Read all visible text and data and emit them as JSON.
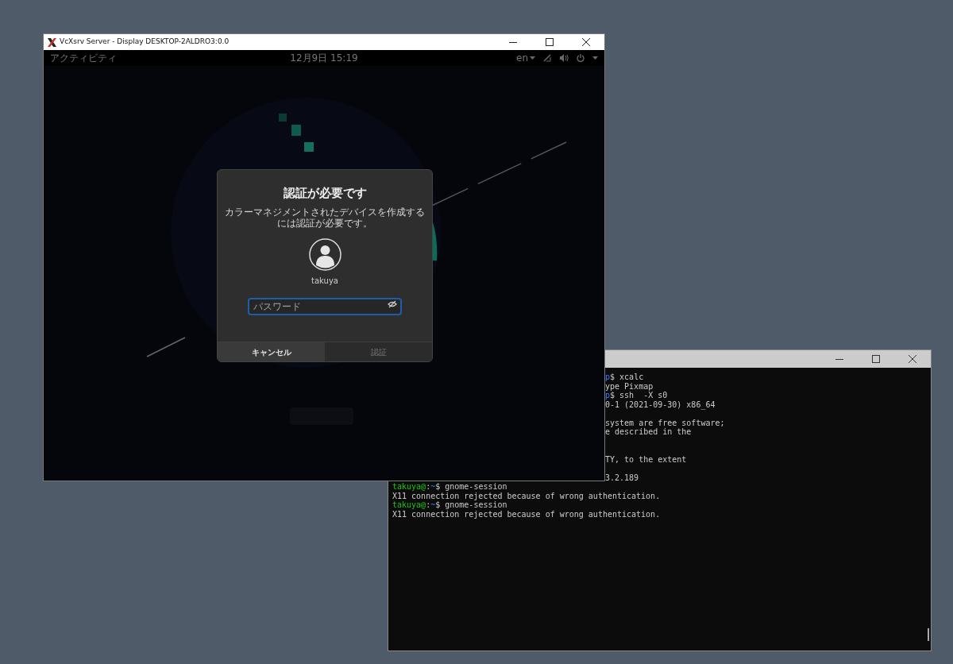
{
  "x_window": {
    "title": "VcXsrv Server - Display DESKTOP-2ALDRO3:0.0",
    "top_bar": {
      "activities": "アクティビティ",
      "clock": "12月9日 15:19",
      "language": "en"
    },
    "dialog": {
      "title": "認証が必要です",
      "message": "カラーマネジメントされたデバイスを作成するには認証が必要です。",
      "user": "takuya",
      "password": {
        "placeholder": "パスワード"
      },
      "buttons": [
        {
          "label": "キャンセル",
          "selected": true,
          "disabled": false
        },
        {
          "label": "認証",
          "selected": false,
          "disabled": true
        }
      ]
    }
  },
  "terminal": {
    "lines": [
      {
        "kind": "partial",
        "segments": [
          {
            "kind": "path",
            "text": "p"
          },
          {
            "kind": "text",
            "text": "$ xcalc"
          }
        ]
      },
      {
        "kind": "partial",
        "segments": [
          {
            "kind": "text",
            "text": "ype Pixmap"
          }
        ]
      },
      {
        "kind": "partial",
        "segments": [
          {
            "kind": "path",
            "text": "p"
          },
          {
            "kind": "text",
            "text": "$ ssh  -X s0"
          }
        ]
      },
      {
        "kind": "partial",
        "segments": [
          {
            "kind": "text",
            "text": "0-1 (2021-09-30) x86_64"
          }
        ]
      },
      {
        "kind": "blank"
      },
      {
        "kind": "partial",
        "segments": [
          {
            "kind": "text",
            "text": "system are free software;"
          }
        ]
      },
      {
        "kind": "partial",
        "segments": [
          {
            "kind": "text",
            "text": "e described in the"
          }
        ]
      },
      {
        "kind": "blank"
      },
      {
        "kind": "blank"
      },
      {
        "kind": "partial",
        "segments": [
          {
            "kind": "text",
            "text": "TY, to the extent"
          }
        ]
      },
      {
        "kind": "blank"
      },
      {
        "kind": "partial",
        "segments": [
          {
            "kind": "text",
            "text": "3.2.189"
          }
        ]
      },
      {
        "kind": "full",
        "segments": [
          {
            "kind": "user",
            "text": "takuya@"
          },
          {
            "kind": "text",
            "text": ":"
          },
          {
            "kind": "path",
            "text": "~"
          },
          {
            "kind": "text",
            "text": "$ gnome-session"
          }
        ]
      },
      {
        "kind": "full",
        "segments": [
          {
            "kind": "text",
            "text": "X11 connection rejected because of wrong authentication."
          }
        ]
      },
      {
        "kind": "full",
        "segments": [
          {
            "kind": "user",
            "text": "takuya@"
          },
          {
            "kind": "text",
            "text": ":"
          },
          {
            "kind": "path",
            "text": "~"
          },
          {
            "kind": "text",
            "text": "$ gnome-session"
          }
        ]
      },
      {
        "kind": "full",
        "segments": [
          {
            "kind": "text",
            "text": "X11 connection rejected because of wrong authentication."
          }
        ]
      }
    ]
  }
}
